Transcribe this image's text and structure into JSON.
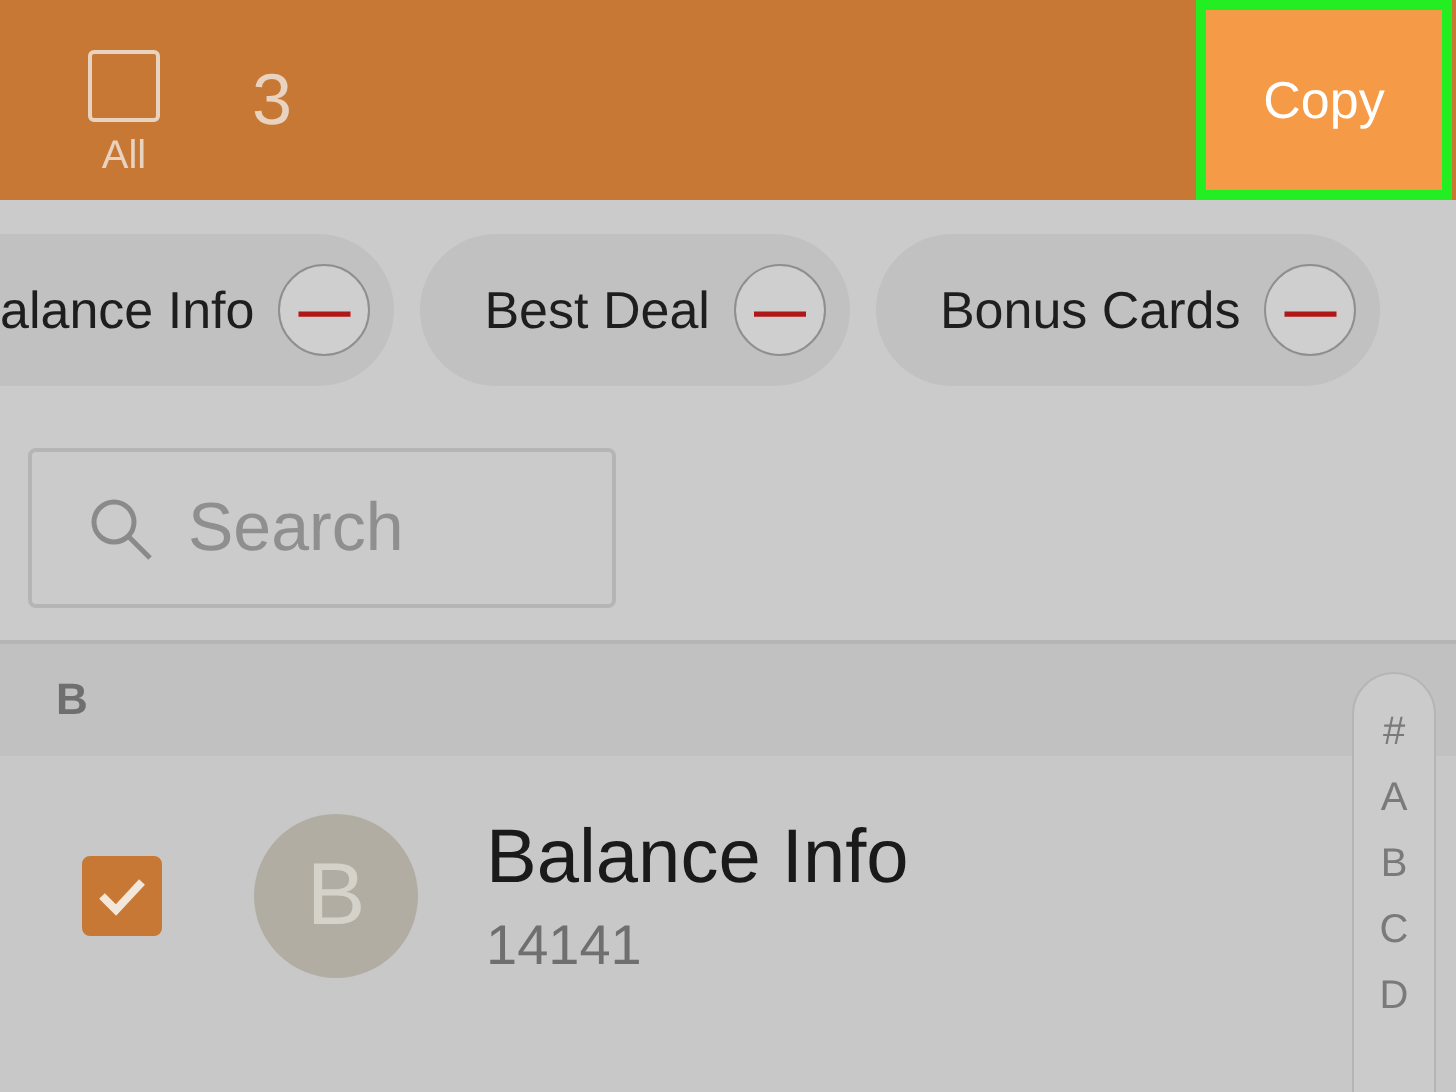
{
  "toolbar": {
    "select_all": {
      "label": "All",
      "checked": false
    },
    "count": "3",
    "copy_button": {
      "label": "Copy",
      "highlighted": true
    }
  },
  "chips": [
    {
      "label": "alance Info",
      "symbol": "—"
    },
    {
      "label": "Best Deal",
      "symbol": "—"
    },
    {
      "label": "Bonus Cards",
      "symbol": "—"
    }
  ],
  "search": {
    "placeholder": "Search"
  },
  "section": {
    "header": "B"
  },
  "contacts": [
    {
      "initial": "B",
      "name": "Balance Info",
      "number": "14141",
      "checked": true
    }
  ],
  "index_bar": [
    "#",
    "A",
    "B",
    "C",
    "D"
  ]
}
